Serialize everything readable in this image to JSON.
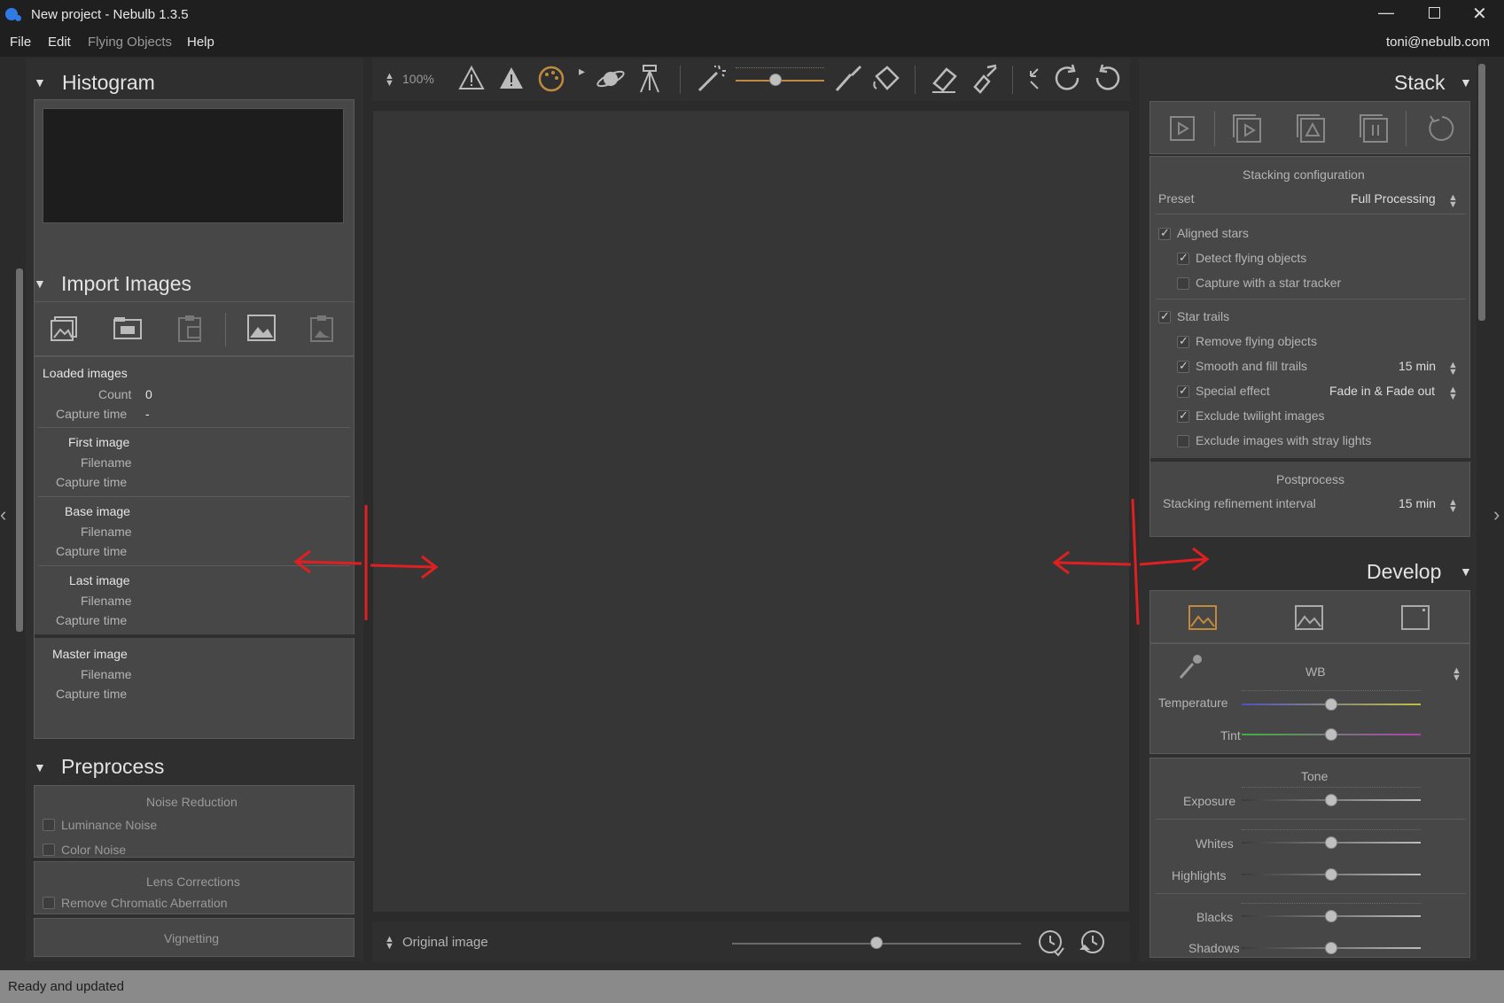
{
  "window": {
    "title": "New project - Nebulb 1.3.5"
  },
  "menu": {
    "file": "File",
    "edit": "Edit",
    "flying": "Flying Objects",
    "help": "Help",
    "account": "toni@nebulb.com"
  },
  "histogram": {
    "title": "Histogram"
  },
  "import": {
    "title": "Import Images",
    "loaded": "Loaded images",
    "count_label": "Count",
    "count_value": "0",
    "capture_label": "Capture time",
    "capture_value": "-",
    "first": "First image",
    "base": "Base image",
    "last": "Last image",
    "master": "Master image",
    "filename": "Filename",
    "capture": "Capture time"
  },
  "preprocess": {
    "title": "Preprocess",
    "noise": "Noise Reduction",
    "luminance": "Luminance Noise",
    "color": "Color Noise",
    "lens": "Lens Corrections",
    "chromatic": "Remove Chromatic Aberration",
    "vignetting": "Vignetting"
  },
  "toolbar": {
    "zoom": "100%",
    "zoom_slider_level": 0.45
  },
  "viewer": {
    "mode": "Original image",
    "compare_slider_level": 0.5
  },
  "stack": {
    "title": "Stack",
    "config": "Stacking configuration",
    "preset_label": "Preset",
    "preset_value": "Full Processing",
    "aligned": "Aligned stars",
    "aligned_checked": true,
    "detect": "Detect flying objects",
    "detect_checked": true,
    "tracker": "Capture with a star tracker",
    "tracker_checked": false,
    "trails": "Star trails",
    "trails_checked": true,
    "remove": "Remove flying objects",
    "remove_checked": true,
    "smooth": "Smooth and fill trails",
    "smooth_checked": true,
    "smooth_value": "15 min",
    "special": "Special effect",
    "special_checked": true,
    "special_value": "Fade in & Fade out",
    "twilight": "Exclude twilight images",
    "twilight_checked": true,
    "stray": "Exclude images with stray lights",
    "stray_checked": false,
    "post": "Postprocess",
    "interval_label": "Stacking refinement interval",
    "interval_value": "15 min"
  },
  "develop": {
    "title": "Develop",
    "wb": "WB",
    "temperature": "Temperature",
    "tint": "Tint",
    "tone": "Tone",
    "exposure": "Exposure",
    "whites": "Whites",
    "highlights": "Highlights",
    "blacks": "Blacks",
    "shadows": "Shadows",
    "slider_levels": {
      "temperature": 0.5,
      "tint": 0.5,
      "exposure": 0.5,
      "whites": 0.5,
      "highlights": 0.5,
      "blacks": 0.5,
      "shadows": 0.5
    }
  },
  "status": {
    "text": "Ready and updated"
  },
  "colors": {
    "accent": "#c08a3e",
    "annotation": "#e02020",
    "app_logo": "#2e7be6"
  }
}
